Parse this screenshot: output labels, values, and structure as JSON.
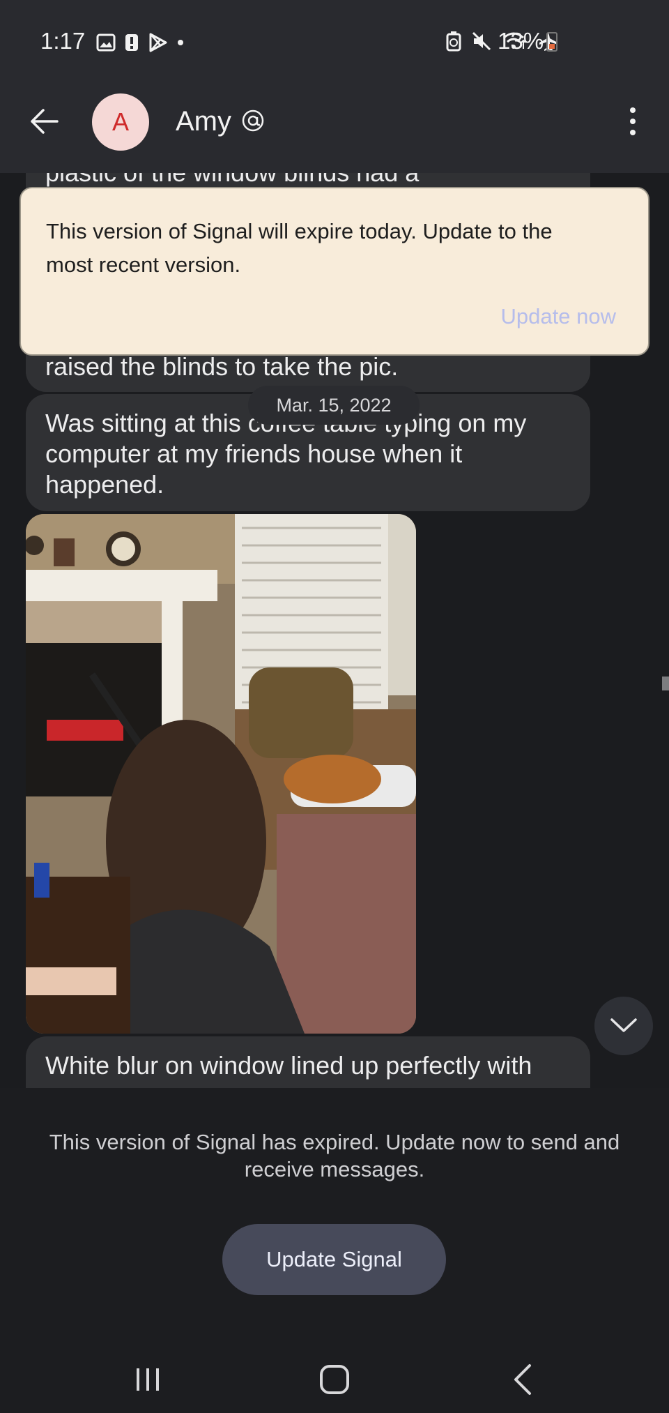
{
  "status_bar": {
    "time": "1:17",
    "battery": "13%"
  },
  "header": {
    "contact_initial": "A",
    "contact_name": "Amy"
  },
  "messages": {
    "partial_top_line": "plastic of the window blinds had a",
    "partial_bottom_line": "raised the blinds to take the pic.",
    "date_divider": "Mar. 15, 2022",
    "message_2": "Was sitting at this coffee table typing on my computer at my friends house when it happened.",
    "message_3": "White blur on window lined up perfectly with"
  },
  "banner": {
    "text": "This version of Signal will expire today. Update to the most recent version.",
    "action": "Update now"
  },
  "footer": {
    "expired_text": "This version of Signal has expired. Update now to send and receive messages.",
    "update_button": "Update Signal"
  },
  "colors": {
    "banner_bg": "#f8ecda",
    "banner_action": "#b6bdeb",
    "button_bg": "#474a5a",
    "avatar_bg": "#f5d8d6",
    "avatar_text": "#cf2a2a"
  },
  "icons": [
    "image-icon",
    "alert-icon",
    "play-store-icon",
    "recycle-icon",
    "mute-icon",
    "wifi-icon",
    "airplane-icon",
    "battery-icon",
    "back-arrow-icon",
    "mention-icon",
    "more-vert-icon",
    "chevron-down-icon",
    "recents-icon",
    "home-icon",
    "nav-back-icon"
  ]
}
